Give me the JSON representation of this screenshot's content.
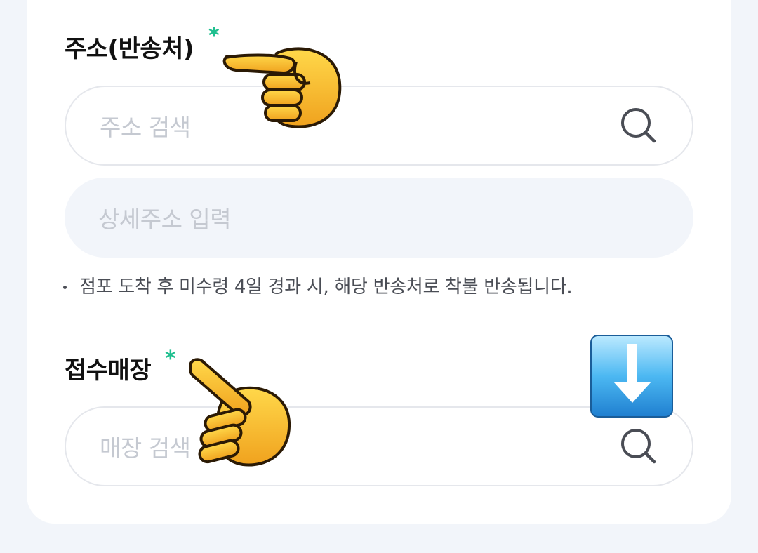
{
  "address": {
    "label": "주소(반송처)",
    "required_mark": "*",
    "search_placeholder": "주소 검색",
    "detail_placeholder": "상세주소 입력",
    "notice": "점포 도착 후 미수령 4일 경과 시, 해당 반송처로 착불 반송됩니다."
  },
  "store": {
    "label": "접수매장",
    "required_mark": "*",
    "search_placeholder": "매장 검색"
  },
  "colors": {
    "required": "#1fbf8f",
    "page_bg": "#f2f5fa",
    "placeholder": "#c5c9d1"
  },
  "icons": [
    "search-icon",
    "pointing-hand-icon",
    "down-arrow-icon"
  ]
}
